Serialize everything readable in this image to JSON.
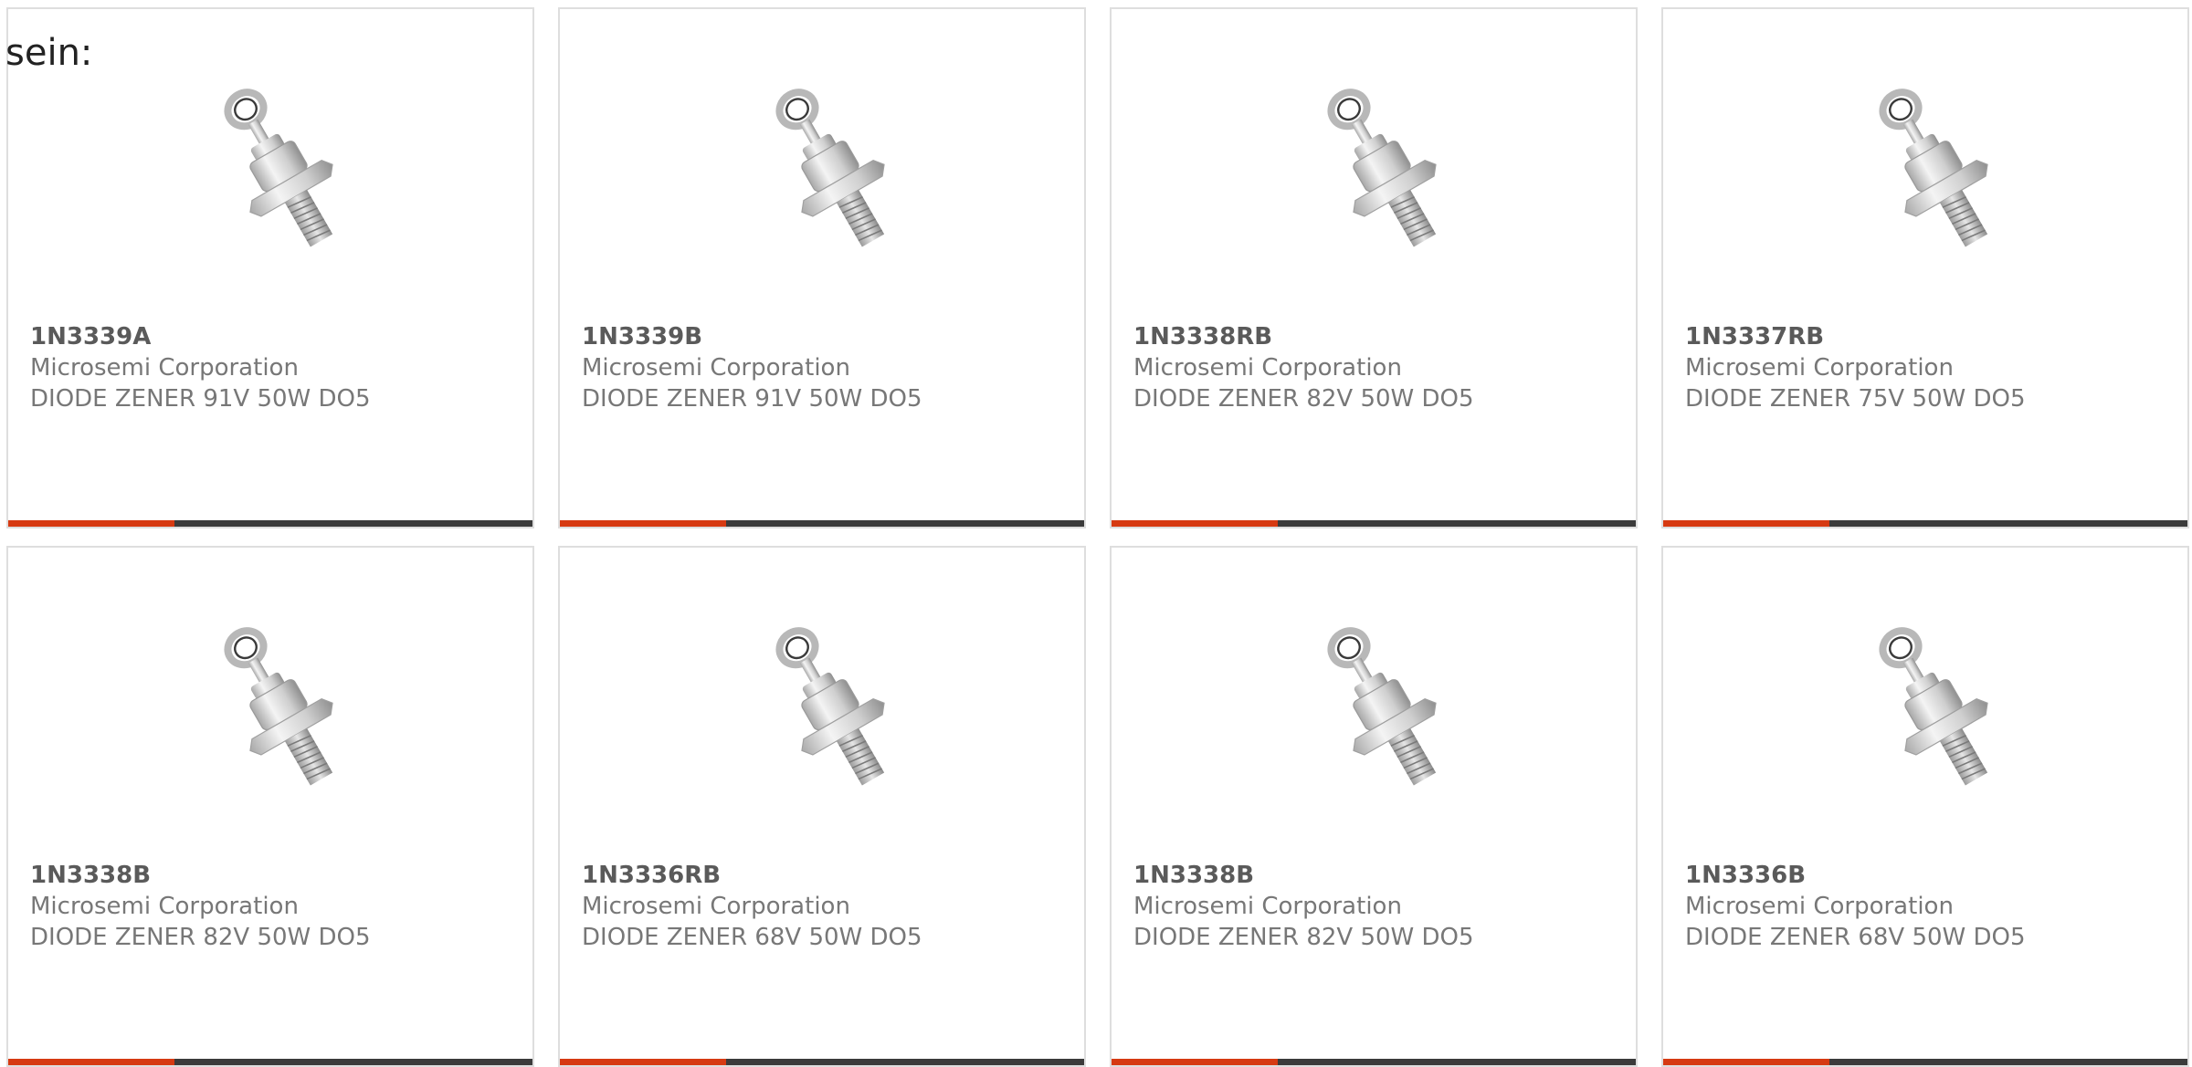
{
  "intro_text": "sein:",
  "colors": {
    "accent": "#d63a12",
    "bar": "#3b3b3b",
    "border": "#dedede",
    "part_number": "#5a5a5a",
    "secondary_text": "#777777"
  },
  "products": [
    {
      "part_number": "1N3339A",
      "manufacturer": "Microsemi Corporation",
      "description": "DIODE ZENER 91V 50W DO5",
      "image_icon": "stud-diode-image"
    },
    {
      "part_number": "1N3339B",
      "manufacturer": "Microsemi Corporation",
      "description": "DIODE ZENER 91V 50W DO5",
      "image_icon": "stud-diode-image"
    },
    {
      "part_number": "1N3338RB",
      "manufacturer": "Microsemi Corporation",
      "description": "DIODE ZENER 82V 50W DO5",
      "image_icon": "stud-diode-image"
    },
    {
      "part_number": "1N3337RB",
      "manufacturer": "Microsemi Corporation",
      "description": "DIODE ZENER 75V 50W DO5",
      "image_icon": "stud-diode-image"
    },
    {
      "part_number": "1N3338B",
      "manufacturer": "Microsemi Corporation",
      "description": "DIODE ZENER 82V 50W DO5",
      "image_icon": "stud-diode-image"
    },
    {
      "part_number": "1N3336RB",
      "manufacturer": "Microsemi Corporation",
      "description": "DIODE ZENER 68V 50W DO5",
      "image_icon": "stud-diode-image"
    },
    {
      "part_number": "1N3338B",
      "manufacturer": "Microsemi Corporation",
      "description": "DIODE ZENER 82V 50W DO5",
      "image_icon": "stud-diode-image"
    },
    {
      "part_number": "1N3336B",
      "manufacturer": "Microsemi Corporation",
      "description": "DIODE ZENER 68V 50W DO5",
      "image_icon": "stud-diode-image"
    }
  ]
}
